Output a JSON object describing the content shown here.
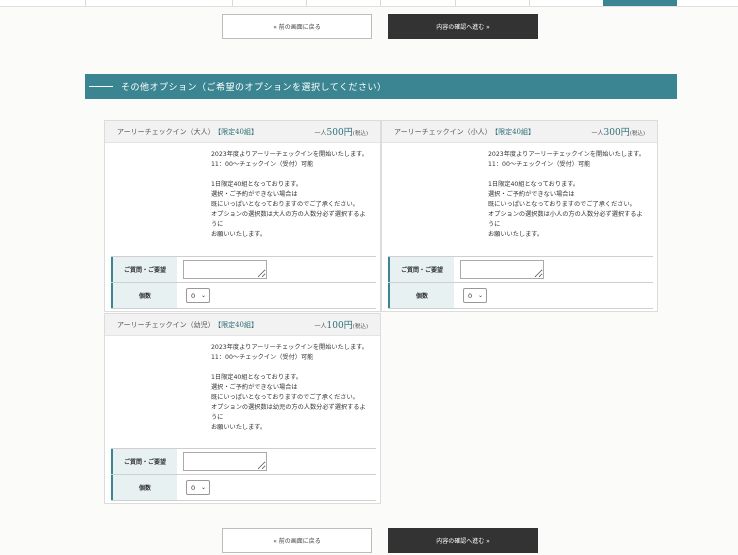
{
  "nav": {
    "back_label": "« 前の画面に戻る",
    "next_label": "内容の確認へ進む »"
  },
  "section": {
    "title": "その他オプション（ご希望のオプションを選択してください）"
  },
  "options": [
    {
      "title": "アーリーチェックイン（大人）",
      "limit": "【限定40組】",
      "price_prefix": "一人",
      "price": "500円",
      "tax": "(税込)",
      "desc": "2023年度よりアーリーチェックインを開始いたします。\n11：00〜チェックイン（受付）可能\n\n1日限定40組となっております。\n選択・ご予約ができない場合は\n既にいっぱいとなっておりますのでご了承ください。\nオプションの選択数は大人の方の人数分必ず選択するよ\nうに\nお願いいたします。",
      "request_label": "ご質問・ご要望",
      "request_value": "",
      "qty_label": "個数",
      "qty_value": "0"
    },
    {
      "title": "アーリーチェックイン（小人）",
      "limit": "【限定40組】",
      "price_prefix": "一人",
      "price": "300円",
      "tax": "(税込)",
      "desc": "2023年度よりアーリーチェックインを開始いたします。\n11：00〜チェックイン（受付）可能\n\n1日限定40組となっております。\n選択・ご予約ができない場合は\n既にいっぱいとなっておりますのでご了承ください。\nオプションの選択数は小人の方の人数分必ず選択するよ\nうに\nお願いいたします。",
      "request_label": "ご質問・ご要望",
      "request_value": "",
      "qty_label": "個数",
      "qty_value": "0"
    },
    {
      "title": "アーリーチェックイン（幼児）",
      "limit": "【限定40組】",
      "price_prefix": "一人",
      "price": "100円",
      "tax": "(税込)",
      "desc": "2023年度よりアーリーチェックインを開始いたします。\n11：00〜チェックイン（受付）可能\n\n1日限定40組となっております。\n選択・ご予約ができない場合は\n既にいっぱいとなっておりますのでご了承ください。\nオプションの選択数は幼児の方の人数分必ず選択するよ\nうに\nお願いいたします。",
      "request_label": "ご質問・ご要望",
      "request_value": "",
      "qty_label": "個数",
      "qty_value": "0"
    }
  ],
  "colors": {
    "accent": "#3a8591",
    "dark_button": "#333333"
  }
}
